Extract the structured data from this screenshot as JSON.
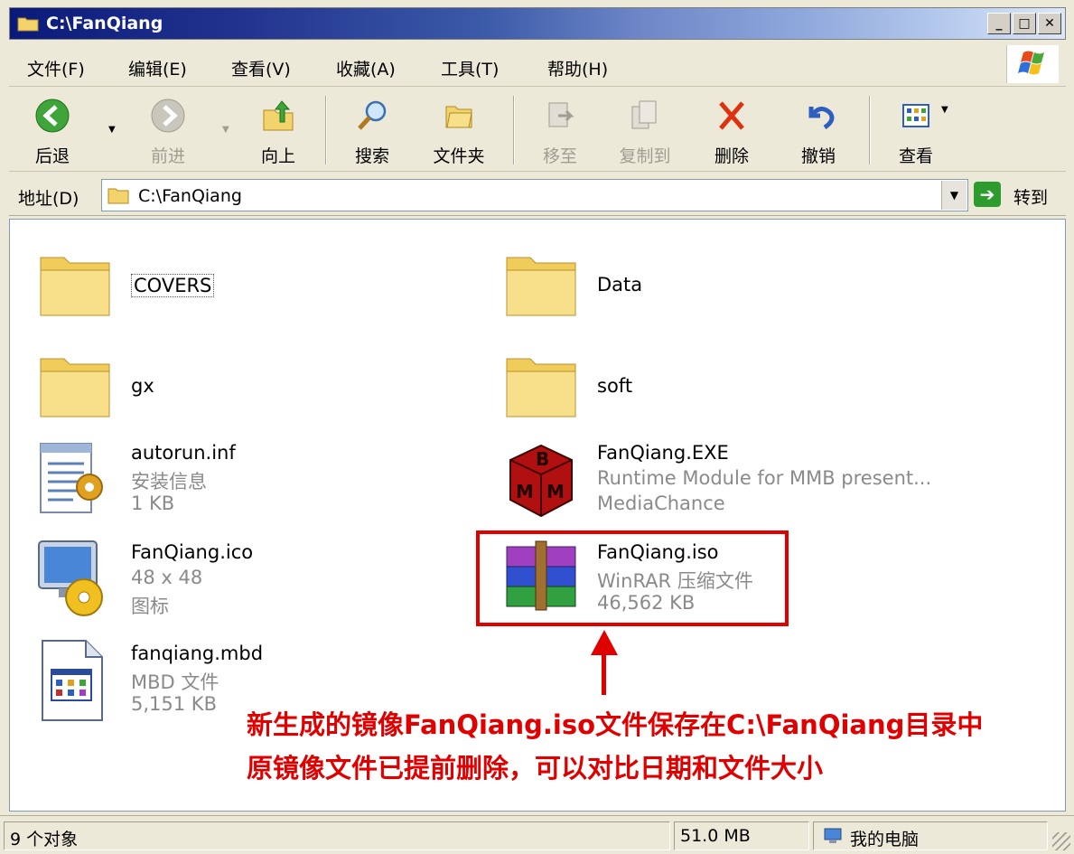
{
  "window": {
    "title": "C:\\FanQiang"
  },
  "menu": [
    {
      "label": "文件(F)"
    },
    {
      "label": "编辑(E)"
    },
    {
      "label": "查看(V)"
    },
    {
      "label": "收藏(A)"
    },
    {
      "label": "工具(T)"
    },
    {
      "label": "帮助(H)"
    }
  ],
  "toolbar": {
    "back": "后退",
    "forward": "前进",
    "up": "向上",
    "search": "搜索",
    "folders": "文件夹",
    "move": "移至",
    "copy": "复制到",
    "delete": "删除",
    "undo": "撤销",
    "view": "查看"
  },
  "address": {
    "label": "地址(D)",
    "value": "C:\\FanQiang",
    "go": "转到"
  },
  "files": [
    {
      "name": "COVERS",
      "icon": "folder-icon"
    },
    {
      "name": "Data",
      "icon": "folder-icon"
    },
    {
      "name": "gx",
      "icon": "folder-icon"
    },
    {
      "name": "soft",
      "icon": "folder-icon"
    },
    {
      "name": "autorun.inf",
      "type": "安装信息",
      "size": "1 KB",
      "icon": "setup-info-icon"
    },
    {
      "name": "FanQiang.EXE",
      "type": "Runtime Module for MMB present...",
      "size": "MediaChance",
      "icon": "mmb-exe-icon"
    },
    {
      "name": "FanQiang.ico",
      "type": "48 x 48",
      "size": "图标",
      "icon": "icon-file-icon"
    },
    {
      "name": "FanQiang.iso",
      "type": "WinRAR 压缩文件",
      "size": "46,562 KB",
      "icon": "winrar-archive-icon"
    },
    {
      "name": "fanqiang.mbd",
      "type": "MBD 文件",
      "size": "5,151 KB",
      "icon": "mbd-file-icon"
    }
  ],
  "annotation": {
    "line1": "新生成的镜像FanQiang.iso文件保存在C:\\FanQiang目录中",
    "line2": "原镜像文件已提前删除，可以对比日期和文件大小"
  },
  "status": {
    "count": "9 个对象",
    "size": "51.0 MB",
    "location": "我的电脑"
  }
}
